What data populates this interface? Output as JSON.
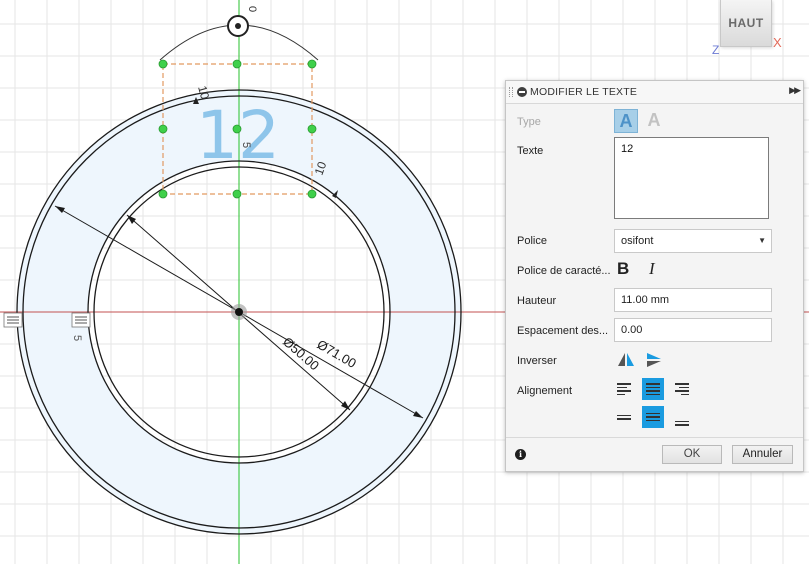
{
  "canvas": {
    "dimension_outer": "Ø71.00",
    "dimension_inner": "Ø50.00",
    "text_preview": "12",
    "side_dim_left": "10",
    "side_dim_right": "10",
    "small_dim": "5",
    "side_marker": "5",
    "top_marker": "0",
    "colors": {
      "fill": "#eef6fd",
      "ring": "#1b1b1b",
      "grid": "#e6e6e6",
      "axis_green": "#27c22c",
      "axis_red": "#c35151",
      "handle": "#3fd04a",
      "bbox": "#e29a62",
      "text_preview": "#8ec5ea"
    }
  },
  "viewcube": {
    "face_label": "HAUT",
    "axis_x": "X",
    "axis_z": "Z"
  },
  "dialog": {
    "title": "MODIFIER LE TEXTE",
    "labels": {
      "type": "Type",
      "text": "Texte",
      "font": "Police",
      "font_style": "Police de caracté...",
      "height": "Hauteur",
      "spacing": "Espacement des...",
      "flip": "Inverser",
      "alignment": "Alignement"
    },
    "text_value": "12",
    "font_value": "osifont",
    "height_value": "11.00 mm",
    "spacing_value": "0.00",
    "type_glyph": "A",
    "bold_glyph": "B",
    "italic_glyph": "I",
    "info_glyph": "i",
    "ok_label": "OK",
    "cancel_label": "Annuler",
    "accent": "#1a9be0"
  }
}
